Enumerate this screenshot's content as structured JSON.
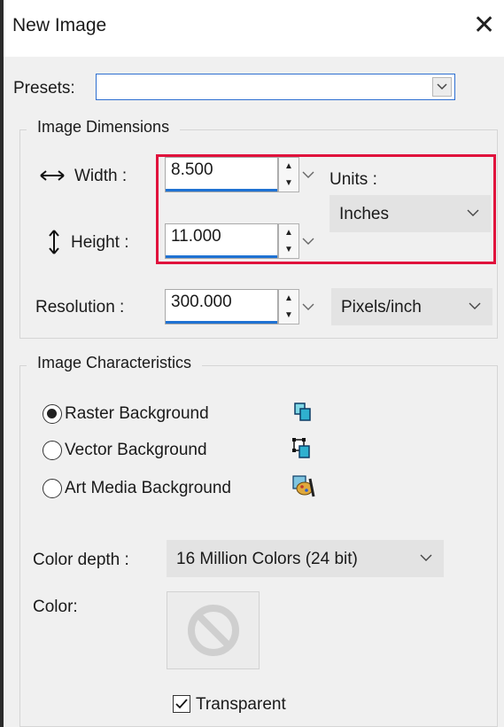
{
  "window": {
    "title": "New Image",
    "close_glyph": "✕"
  },
  "presets": {
    "label": "Presets:",
    "value": ""
  },
  "image_dimensions": {
    "title": "Image Dimensions",
    "width": {
      "label": "Width :",
      "value": "8.500",
      "icon": "horizontal-resize-icon"
    },
    "height": {
      "label": "Height :",
      "value": "11.000",
      "icon": "vertical-resize-icon"
    },
    "units": {
      "label": "Units :",
      "value": "Inches"
    },
    "resolution": {
      "label": "Resolution :",
      "value": "300.000",
      "units": "Pixels/inch"
    }
  },
  "image_characteristics": {
    "title": "Image Characteristics",
    "options": [
      {
        "label": "Raster Background",
        "selected": true,
        "icon": "raster-layer-icon"
      },
      {
        "label": "Vector Background",
        "selected": false,
        "icon": "vector-layer-icon"
      },
      {
        "label": "Art Media Background",
        "selected": false,
        "icon": "art-media-layer-icon"
      }
    ],
    "color_depth": {
      "label": "Color depth :",
      "value": "16 Million Colors (24 bit)"
    },
    "color": {
      "label": "Color:",
      "icon": "no-color-icon"
    },
    "transparent": {
      "label": "Transparent",
      "checked": true
    }
  },
  "colors": {
    "accent": "#1f72d3",
    "highlight": "#e0123c",
    "dialog_bg": "#f0f0f0"
  }
}
